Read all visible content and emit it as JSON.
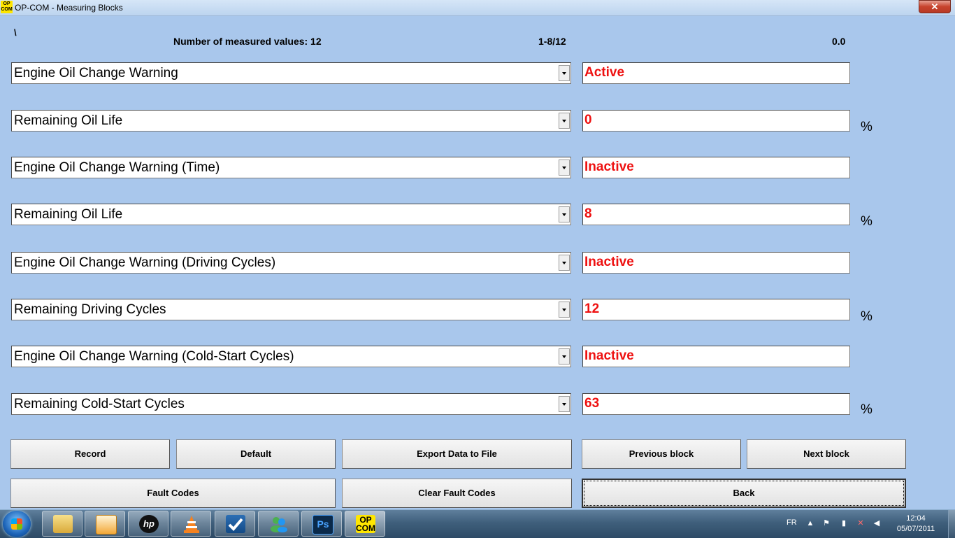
{
  "window": {
    "title": "OP-COM - Measuring Blocks",
    "app_icon_text_1": "OP",
    "app_icon_text_2": "COM",
    "close_label": "✕"
  },
  "header": {
    "marker": "\\",
    "measured_label": "Number of measured values: 12",
    "range": "1-8/12",
    "value": "0.0"
  },
  "rows": [
    {
      "name": "Engine Oil Change Warning",
      "value": "Active",
      "unit": ""
    },
    {
      "name": "Remaining Oil Life",
      "value": "0",
      "unit": "%"
    },
    {
      "name": "Engine Oil Change Warning (Time)",
      "value": "Inactive",
      "unit": ""
    },
    {
      "name": "Remaining Oil Life",
      "value": "8",
      "unit": "%"
    },
    {
      "name": "Engine Oil Change Warning (Driving Cycles)",
      "value": "Inactive",
      "unit": ""
    },
    {
      "name": "Remaining Driving Cycles",
      "value": "12",
      "unit": "%"
    },
    {
      "name": "Engine Oil Change Warning (Cold-Start Cycles)",
      "value": "Inactive",
      "unit": ""
    },
    {
      "name": "Remaining Cold-Start Cycles",
      "value": "63",
      "unit": "%"
    }
  ],
  "buttons": {
    "record": "Record",
    "default": "Default",
    "export": "Export Data to File",
    "previous": "Previous block",
    "next": "Next block",
    "fault_codes": "Fault Codes",
    "clear_fault_codes": "Clear Fault Codes",
    "back": "Back"
  },
  "taskbar": {
    "apps": [
      "explorer-icon",
      "media-player-icon",
      "hp-icon",
      "vlc-icon",
      "app-check-icon",
      "messenger-icon",
      "photoshop-icon",
      "opcom-icon"
    ],
    "photoshop_label": "Ps",
    "opcom_label_1": "OP",
    "opcom_label_2": "COM",
    "language": "FR",
    "time": "12:04",
    "date": "05/07/2011"
  },
  "colors": {
    "background": "#a9c7ec",
    "value_text": "#e11111",
    "opcom_yellow": "#ffe600"
  }
}
